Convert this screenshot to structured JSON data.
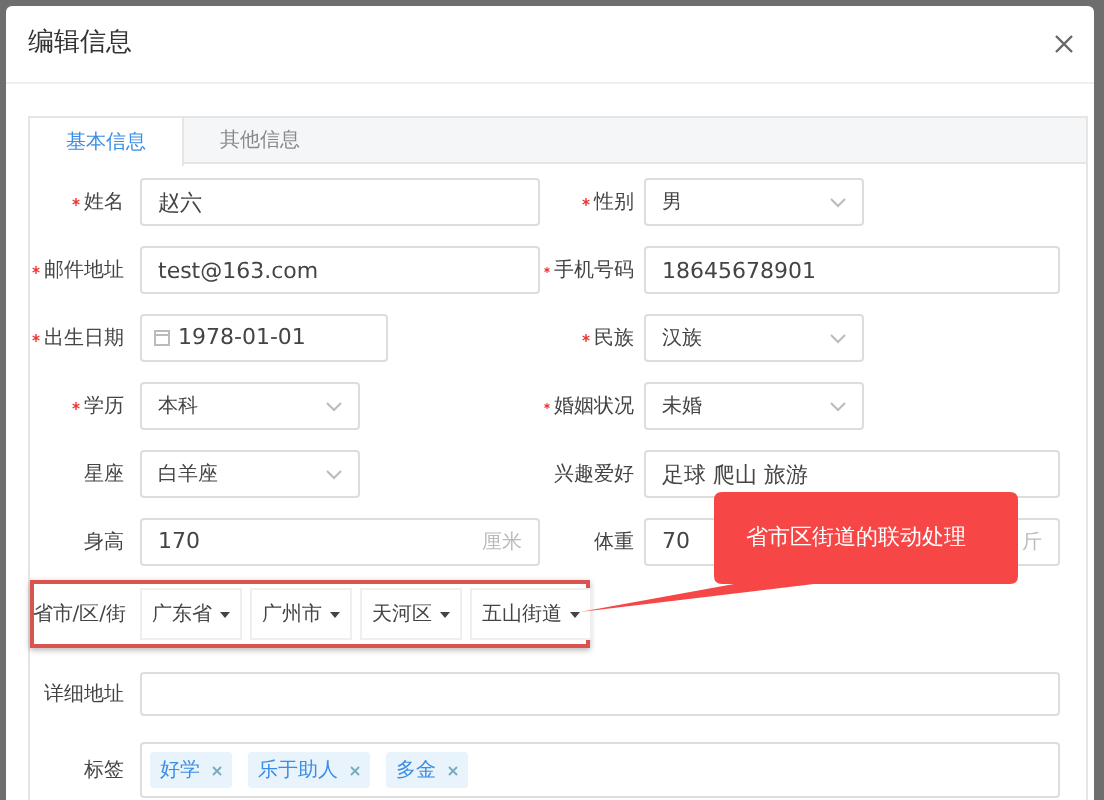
{
  "dialog": {
    "title": "编辑信息"
  },
  "tabs": [
    {
      "label": "基本信息",
      "selected": true
    },
    {
      "label": "其他信息",
      "selected": false
    }
  ],
  "rows": [
    [
      {
        "label": "姓名",
        "required": true,
        "kind": "text",
        "value": "赵六"
      },
      {
        "label": "性别",
        "required": true,
        "kind": "select",
        "value": "男"
      }
    ],
    [
      {
        "label": "邮件地址",
        "required": true,
        "kind": "text",
        "value": "test@163.com"
      },
      {
        "label": "手机号码",
        "required": true,
        "kind": "text",
        "value": "18645678901"
      }
    ],
    [
      {
        "label": "出生日期",
        "required": true,
        "kind": "date",
        "value": "1978-01-01"
      },
      {
        "label": "民族",
        "required": true,
        "kind": "select",
        "value": "汉族"
      }
    ],
    [
      {
        "label": "学历",
        "required": true,
        "kind": "select",
        "value": "本科"
      },
      {
        "label": "婚姻状况",
        "required": true,
        "kind": "select",
        "value": "未婚"
      }
    ],
    [
      {
        "label": "星座",
        "required": false,
        "kind": "select",
        "value": "白羊座"
      },
      {
        "label": "兴趣爱好",
        "required": false,
        "kind": "text",
        "value": "足球 爬山 旅游"
      }
    ],
    [
      {
        "label": "身高",
        "required": false,
        "kind": "suffix",
        "value": "170",
        "suffix": "厘米"
      },
      {
        "label": "体重",
        "required": false,
        "kind": "suffix",
        "value": "70",
        "suffix": "斤"
      }
    ]
  ],
  "region": {
    "label": "省市/区/街",
    "highlighted": true,
    "dropdowns": [
      "广东省",
      "广州市",
      "天河区",
      "五山街道"
    ]
  },
  "address": {
    "label": "详细地址"
  },
  "tags_field": {
    "label": "标签",
    "tags": [
      "好学",
      "乐于助人",
      "多金"
    ]
  },
  "callout": {
    "text": "省市区街道的联动处理"
  }
}
